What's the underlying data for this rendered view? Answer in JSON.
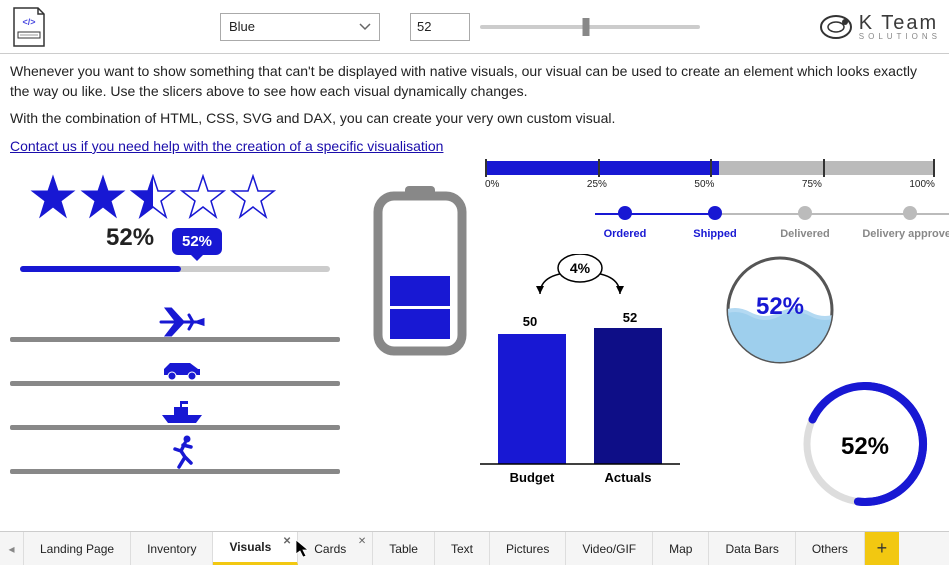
{
  "topbar": {
    "color_select": "Blue",
    "value": "52"
  },
  "logo": {
    "main": "K Team",
    "sub": "SOLUTIONS"
  },
  "intro": {
    "p1": "Whenever you want to show something that can't be displayed with native visuals, our visual can be used to create an element which looks exactly the way ou like. Use the slicers above to see how each visual dynamically changes.",
    "p2": "With the combination of HTML, CSS, SVG and DAX, you can create your very own custom visual.",
    "link": "Contact us if you need help with the creation of a specific visualisation"
  },
  "percent_label": "52%",
  "bubble_label": "52%",
  "scale_labels": [
    "0%",
    "25%",
    "50%",
    "75%",
    "100%"
  ],
  "steps": [
    {
      "label": "Ordered",
      "active": true
    },
    {
      "label": "Shipped",
      "active": true
    },
    {
      "label": "Delivered",
      "active": false
    },
    {
      "label": "Delivery approved",
      "active": false
    }
  ],
  "barchart": {
    "delta_label": "4%",
    "budget_value": "50",
    "actuals_value": "52",
    "budget_label": "Budget",
    "actuals_label": "Actuals"
  },
  "gauge_label": "52%",
  "radial_label": "52%",
  "tabs": [
    "Landing Page",
    "Inventory",
    "Visuals",
    "Cards",
    "Table",
    "Text",
    "Pictures",
    "Video/GIF",
    "Map",
    "Data Bars",
    "Others"
  ],
  "colors": {
    "accent": "#1818d3",
    "accent_dark": "#0e0e87"
  },
  "chart_data": {
    "type": "bar",
    "categories": [
      "Budget",
      "Actuals"
    ],
    "values": [
      50,
      52
    ],
    "delta_pct": 4,
    "ylim": [
      0,
      60
    ],
    "title": "",
    "ylabel": "",
    "xlabel": ""
  }
}
